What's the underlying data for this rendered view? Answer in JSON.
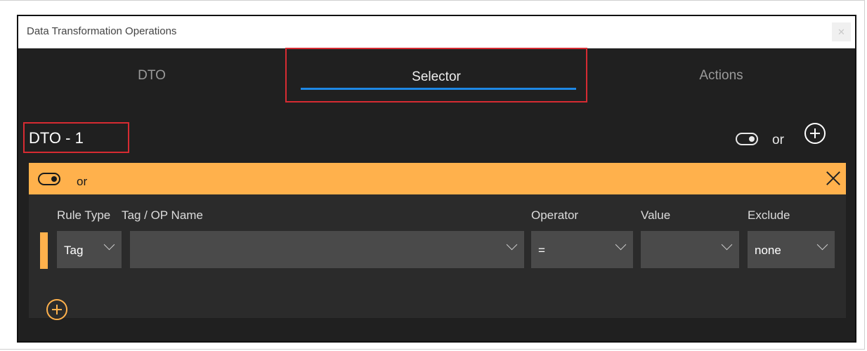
{
  "window": {
    "title": "Data Transformation Operations",
    "close_glyph": "✕"
  },
  "tabs": [
    {
      "label": "DTO"
    },
    {
      "label": "Selector"
    },
    {
      "label": "Actions"
    }
  ],
  "dto": {
    "name": "DTO - 1",
    "or_label": "or"
  },
  "group": {
    "or_label": "or"
  },
  "columns": {
    "rule_type": "Rule Type",
    "tag_name": "Tag / OP Name",
    "operator": "Operator",
    "value": "Value",
    "exclude": "Exclude"
  },
  "rule": {
    "rule_type": "Tag",
    "tag_name": "",
    "operator": "=",
    "value": "",
    "exclude": "none"
  },
  "colors": {
    "accent": "#ffb14c",
    "tab_underline": "#1e88e5",
    "highlight_box": "#d62b32"
  }
}
